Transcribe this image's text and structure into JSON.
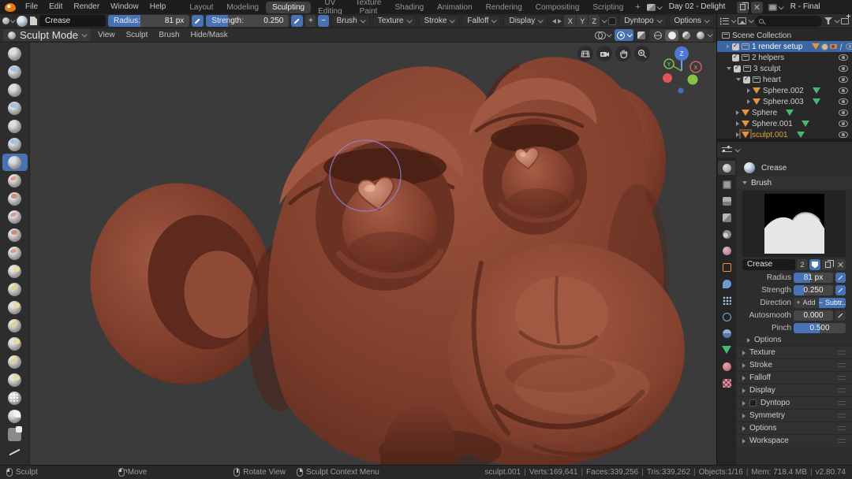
{
  "menubar": {
    "menus": [
      {
        "label": "File"
      },
      {
        "label": "Edit"
      },
      {
        "label": "Render"
      },
      {
        "label": "Window"
      },
      {
        "label": "Help"
      }
    ],
    "workspace_tabs": [
      {
        "label": "Layout"
      },
      {
        "label": "Modeling"
      },
      {
        "label": "Sculpting",
        "active": true
      },
      {
        "label": "UV Editing"
      },
      {
        "label": "Texture Paint"
      },
      {
        "label": "Shading"
      },
      {
        "label": "Animation"
      },
      {
        "label": "Rendering"
      },
      {
        "label": "Compositing"
      },
      {
        "label": "Scripting"
      }
    ],
    "add_workspace_label": "+",
    "scene_name": "Day 02 - Delight",
    "view_layer_name": "R - Final"
  },
  "tool_settings": {
    "brush_name": "Crease",
    "radius_label": "Radius:",
    "radius_value": "81 px",
    "radius_fill_pct": 40,
    "strength_label": "Strength:",
    "strength_value": "0.250",
    "strength_fill_pct": 26,
    "add_button": "+",
    "subtract_button": "−",
    "menus": [
      {
        "label": "Brush"
      },
      {
        "label": "Texture"
      },
      {
        "label": "Stroke"
      },
      {
        "label": "Falloff"
      },
      {
        "label": "Display"
      }
    ],
    "mirror_axes": [
      {
        "label": "X"
      },
      {
        "label": "Y"
      },
      {
        "label": "Z"
      }
    ],
    "dyntopo_label": "Dyntopo",
    "options_label": "Options"
  },
  "viewport_header": {
    "mode": "Sculpt Mode",
    "menus": [
      {
        "label": "View"
      },
      {
        "label": "Sculpt"
      },
      {
        "label": "Brush"
      },
      {
        "label": "Hide/Mask"
      }
    ]
  },
  "viewport": {
    "axis_x": "X",
    "axis_y": "Y",
    "axis_z": "Z"
  },
  "toolbar_tools": [
    {
      "id": "draw",
      "kind": "k-blue"
    },
    {
      "id": "clay",
      "kind": "k-blue2"
    },
    {
      "id": "clay-strips",
      "kind": "k-blue"
    },
    {
      "id": "layer",
      "kind": "k-blue2"
    },
    {
      "id": "inflate",
      "kind": "k-blue"
    },
    {
      "id": "blob",
      "kind": "k-blue2"
    },
    {
      "id": "crease",
      "kind": "k-blue",
      "active": true
    },
    {
      "id": "smooth",
      "kind": "k-red"
    },
    {
      "id": "flatten",
      "kind": "k-red2"
    },
    {
      "id": "fill",
      "kind": "k-red"
    },
    {
      "id": "scrape",
      "kind": "k-red2"
    },
    {
      "id": "pinch",
      "kind": "k-red"
    },
    {
      "id": "grab",
      "kind": "k-yel"
    },
    {
      "id": "elastic-deform",
      "kind": "k-yel2"
    },
    {
      "id": "snake-hook",
      "kind": "k-yel"
    },
    {
      "id": "thumb",
      "kind": "k-yel2"
    },
    {
      "id": "pose",
      "kind": "k-yel"
    },
    {
      "id": "nudge",
      "kind": "k-yel2"
    },
    {
      "id": "rotate",
      "kind": "k-yel"
    },
    {
      "id": "simplify",
      "kind": "k-white"
    },
    {
      "id": "mask",
      "kind": "k-mask"
    },
    {
      "id": "box-mask",
      "kind": "k-box"
    },
    {
      "id": "annotate",
      "kind": "k-pen"
    }
  ],
  "outliner": {
    "collection_label": "Scene Collection",
    "rows": [
      {
        "label": "1 render setup"
      },
      {
        "label": "2 helpers"
      },
      {
        "label": "3 sculpt"
      },
      {
        "label": "heart"
      },
      {
        "label": "Sphere.002"
      },
      {
        "label": "Sphere.003"
      },
      {
        "label": "Sphere"
      },
      {
        "label": "Sphere.001"
      },
      {
        "label": "sculpt.001"
      }
    ]
  },
  "properties": {
    "active_tool_name": "Crease",
    "brush_panel_label": "Brush",
    "brush_name_field": "Crease",
    "brush_users_count": "2",
    "radius_label": "Radius",
    "radius_value": "81 px",
    "radius_fill_pct": 42,
    "strength_label": "Strength",
    "strength_value": "0.250",
    "strength_fill_pct": 26,
    "direction_label": "Direction",
    "direction_add_sign": "+",
    "direction_add": "Add",
    "direction_subtract_sign": "−",
    "direction_subtract": "Subtr..",
    "autosmooth_label": "Autosmooth",
    "autosmooth_value": "0.000",
    "autosmooth_fill_pct": 0,
    "pinch_label": "Pinch",
    "pinch_value": "0.500",
    "pinch_fill_pct": 50,
    "brush_subpanel": "Options",
    "panels": [
      {
        "label": "Texture"
      },
      {
        "label": "Stroke"
      },
      {
        "label": "Falloff"
      },
      {
        "label": "Display"
      },
      {
        "label": "Dyntopo",
        "checkbox": true
      },
      {
        "label": "Symmetry"
      },
      {
        "label": "Options"
      },
      {
        "label": "Workspace"
      }
    ]
  },
  "statusbar": {
    "hints": [
      {
        "label": "Sculpt",
        "mouse": "lmb"
      },
      {
        "label": "Move",
        "mouse": "lmb-drag"
      },
      {
        "label": "Rotate View",
        "mouse": "mmb"
      },
      {
        "label": "Sculpt Context Menu",
        "mouse": "rmb"
      }
    ],
    "separator": "|",
    "stats": [
      {
        "text": "sculpt.001"
      },
      {
        "text": "Verts:169,641"
      },
      {
        "text": "Faces:339,256"
      },
      {
        "text": "Tris:339,262"
      },
      {
        "text": "Objects:1/16"
      },
      {
        "text": "Mem: 718.4 MB"
      },
      {
        "text": "v2.80.74"
      }
    ]
  },
  "colors": {
    "accent": "#4772b3",
    "selection": "#3a66a4",
    "active_object_text": "#dca13a",
    "viewport_background": "#3b3b3b",
    "clay_base": "#8f4c38"
  }
}
